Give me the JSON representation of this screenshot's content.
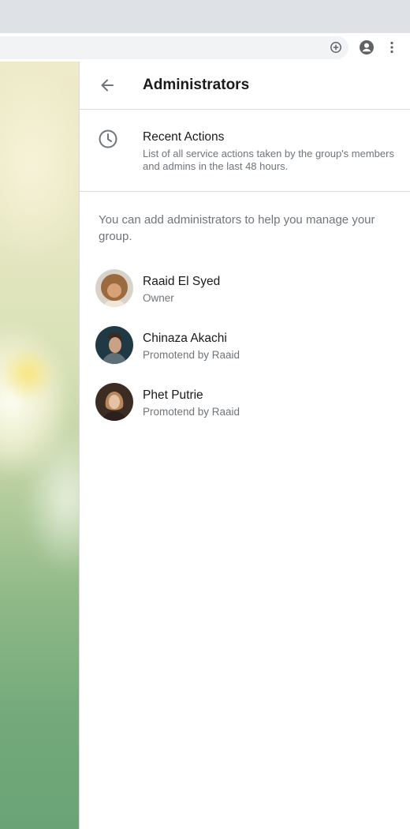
{
  "panel": {
    "title": "Administrators",
    "recent_actions": {
      "title": "Recent Actions",
      "description": "List of all service actions taken by the group's members and admins in the last 48 hours."
    },
    "info_text": "You can add administrators to help you manage your group.",
    "admins": [
      {
        "name": "Raaid El Syed",
        "role": "Owner"
      },
      {
        "name": "Chinaza Akachi",
        "role": "Promotend by Raaid"
      },
      {
        "name": "Phet Putrie",
        "role": "Promotend by Raaid"
      }
    ]
  },
  "colors": {
    "primary_text": "#1a1a1a",
    "secondary_text": "#707579",
    "divider": "#dadada",
    "browser_chrome": "#dee1e6"
  }
}
